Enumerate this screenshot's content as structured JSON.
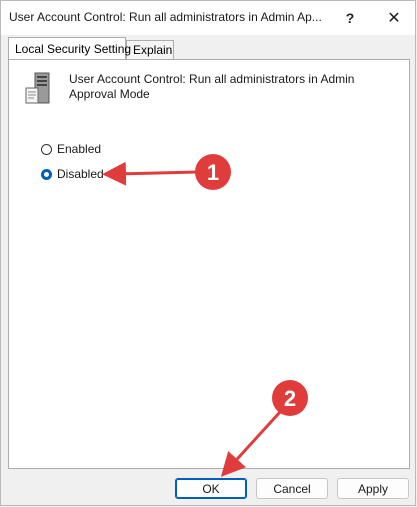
{
  "window": {
    "title": "User Account Control: Run all administrators in Admin Ap..."
  },
  "titlebar": {
    "help_label": "?",
    "close_label": "✕"
  },
  "tabs": [
    {
      "label": "Local Security Setting",
      "active": true
    },
    {
      "label": "Explain",
      "active": false
    }
  ],
  "policy": {
    "name": "User Account Control: Run all administrators in Admin Approval Mode",
    "icon": "server-policy-icon"
  },
  "options": [
    {
      "label": "Enabled",
      "selected": false
    },
    {
      "label": "Disabled",
      "selected": true
    }
  ],
  "buttons": {
    "ok": "OK",
    "cancel": "Cancel",
    "apply": "Apply"
  },
  "annotations": [
    {
      "number": "1",
      "color": "#e03c3c"
    },
    {
      "number": "2",
      "color": "#e03c3c"
    }
  ]
}
